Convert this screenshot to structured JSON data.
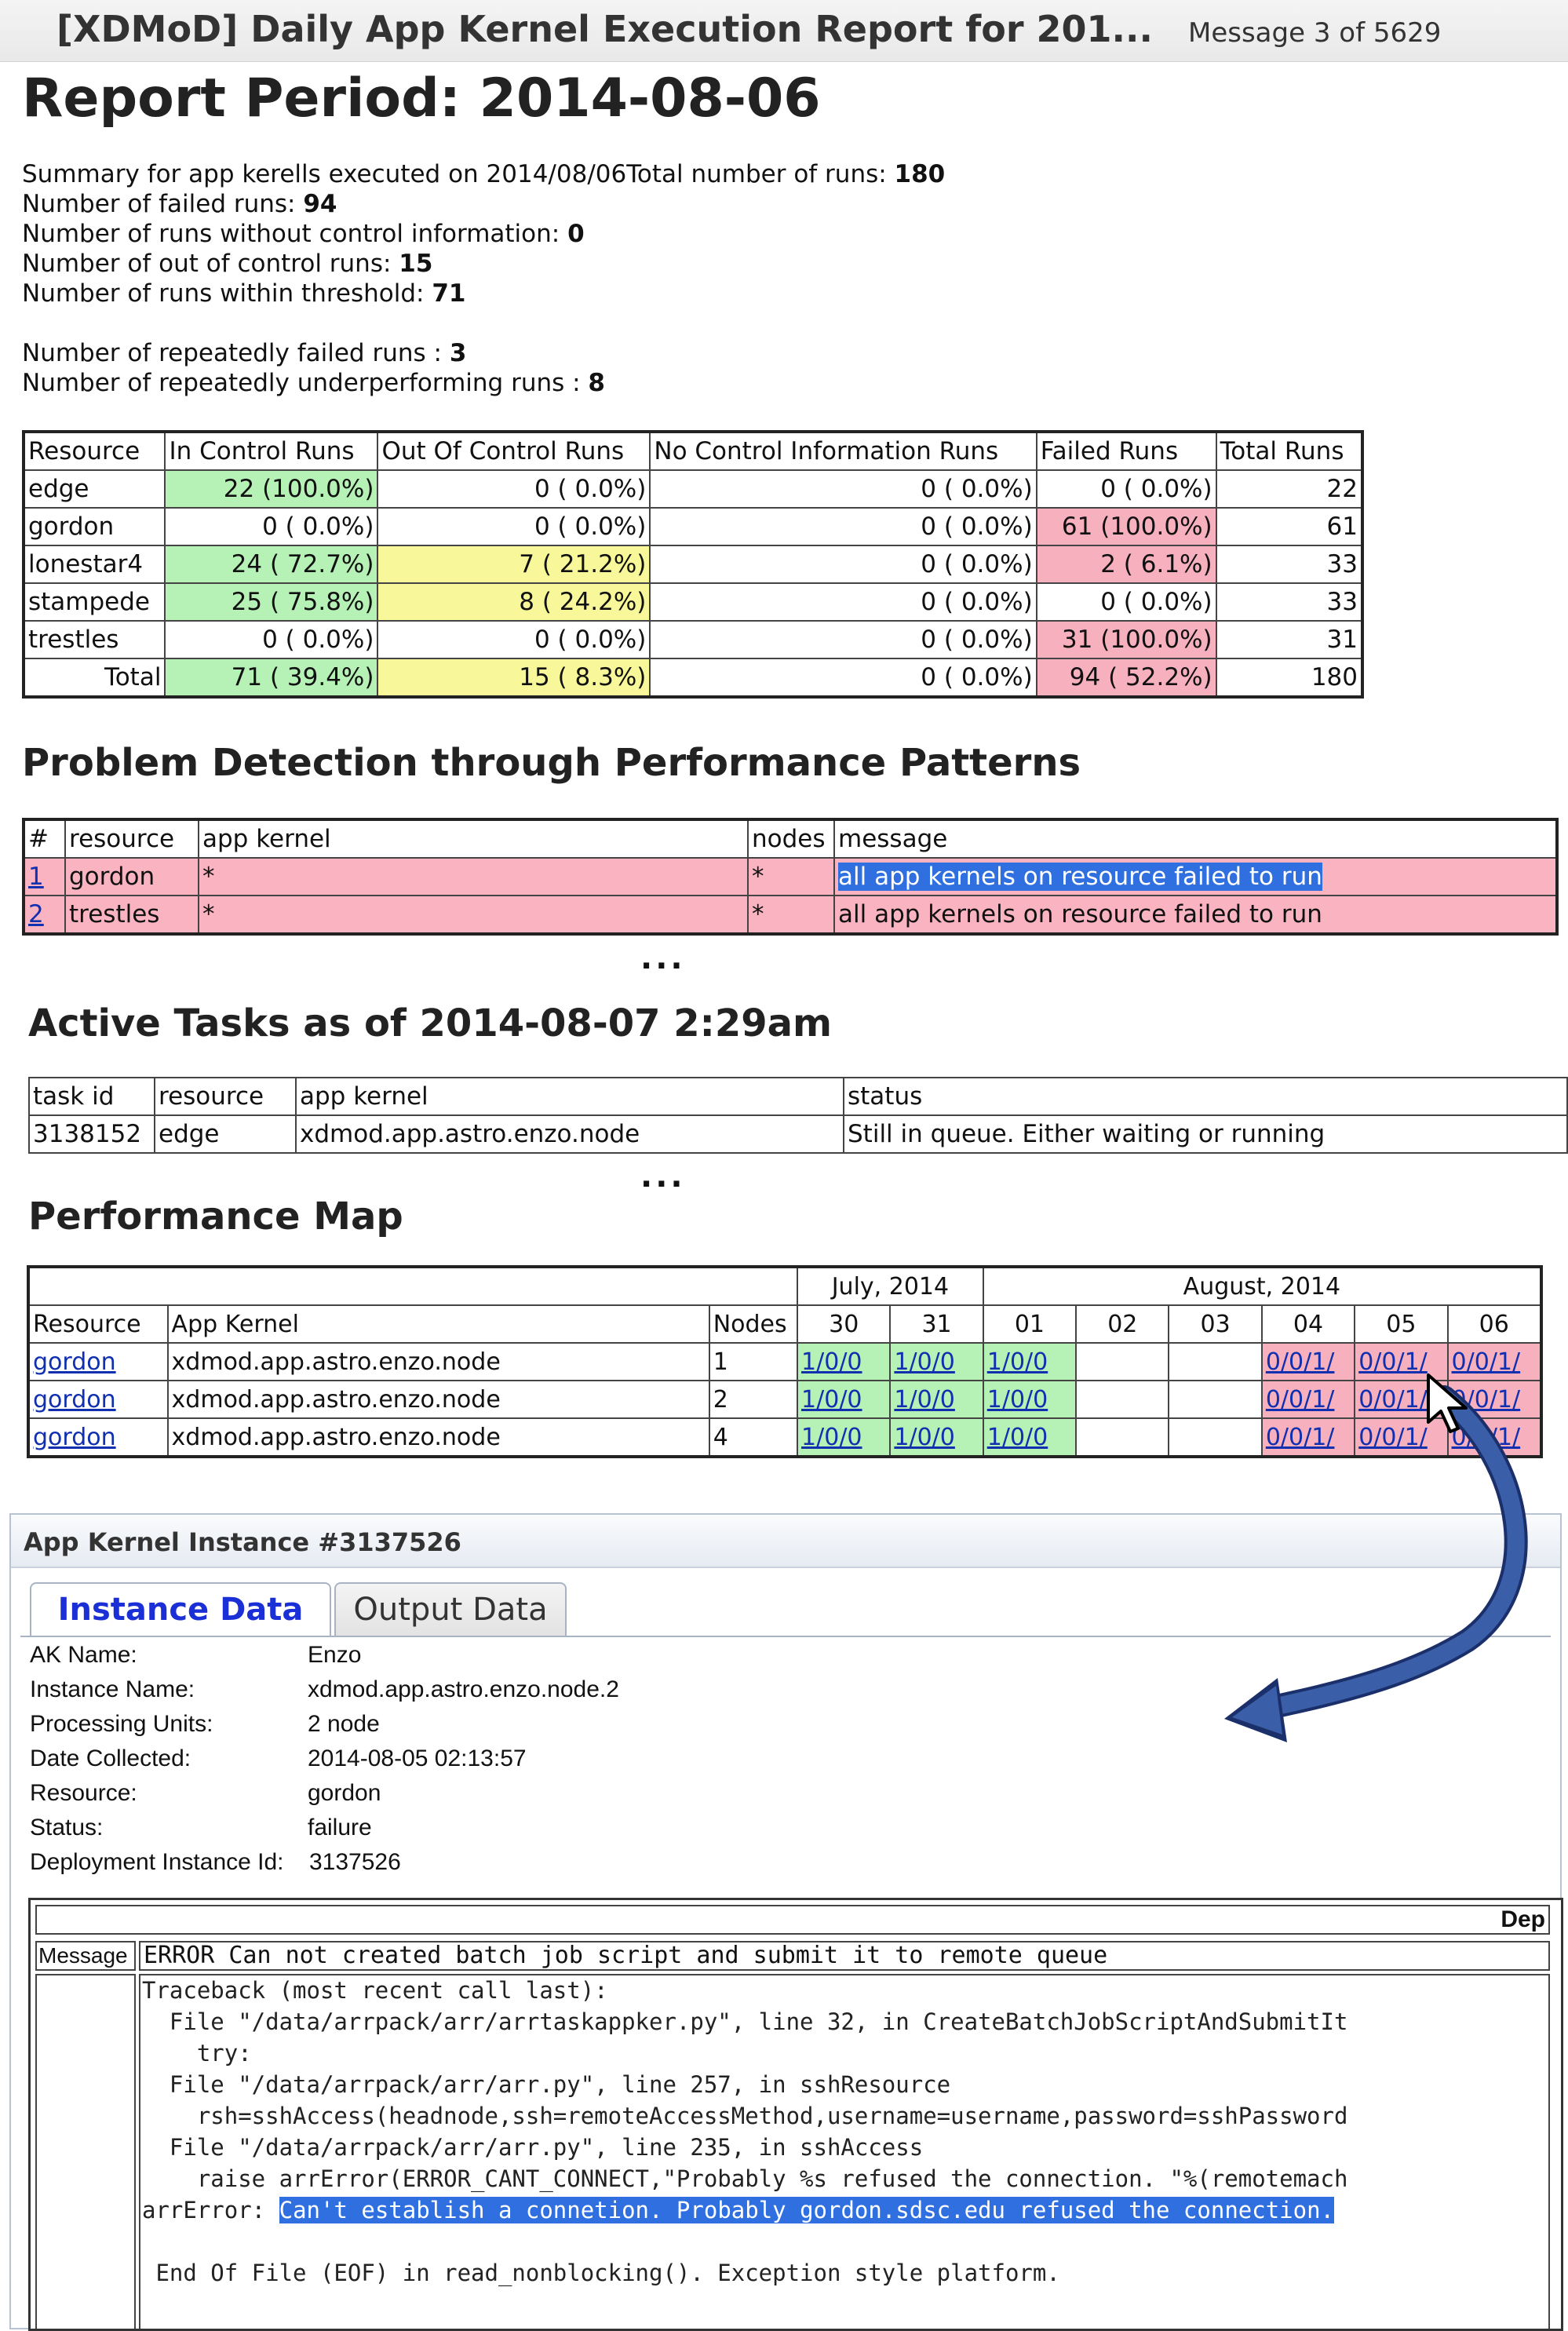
{
  "email": {
    "subject": "[XDMoD] Daily App Kernel Execution Report for 201...",
    "message_counter": "Message 3 of 5629"
  },
  "report": {
    "title": "Report Period: 2014-08-06",
    "summary_prefix": "Summary for app kerells executed on 2014/08/06",
    "total_runs_label": "Total number of runs: ",
    "total_runs": "180",
    "failed_label": "Number of failed runs: ",
    "failed": "94",
    "no_control_label": "Number of runs without control information: ",
    "no_control": "0",
    "out_of_control_label": "Number of out of control runs: ",
    "out_of_control": "15",
    "within_threshold_label": "Number of runs within threshold: ",
    "within_threshold": "71",
    "repeated_failed_label": "Number of repeatedly failed runs : ",
    "repeated_failed": "3",
    "repeated_under_label": "Number of repeatedly underperforming runs : ",
    "repeated_under": "8"
  },
  "summary_table": {
    "headers": [
      "Resource",
      "In Control Runs",
      "Out Of Control Runs",
      "No Control Information Runs",
      "Failed Runs",
      "Total Runs"
    ],
    "rows": [
      [
        "edge",
        "22 (100.0%)",
        "0 (  0.0%)",
        "0 (  0.0%)",
        "0 (  0.0%)",
        "22"
      ],
      [
        "gordon",
        "0 (  0.0%)",
        "0 (  0.0%)",
        "0 (  0.0%)",
        "61 (100.0%)",
        "61"
      ],
      [
        "lonestar4",
        "24 ( 72.7%)",
        "7 ( 21.2%)",
        "0 (  0.0%)",
        "2 (  6.1%)",
        "33"
      ],
      [
        "stampede",
        "25 ( 75.8%)",
        "8 ( 24.2%)",
        "0 (  0.0%)",
        "0 (  0.0%)",
        "33"
      ],
      [
        "trestles",
        "0 (  0.0%)",
        "0 (  0.0%)",
        "0 (  0.0%)",
        "31 (100.0%)",
        "31"
      ],
      [
        "Total",
        "71 ( 39.4%)",
        "15 (  8.3%)",
        "0 (  0.0%)",
        "94 ( 52.2%)",
        "180"
      ]
    ]
  },
  "problem_detection": {
    "title": "Problem Detection through Performance Patterns",
    "headers": [
      "#",
      "resource",
      "app kernel",
      "nodes",
      "message"
    ],
    "rows": [
      [
        "1",
        "gordon",
        "*",
        "*",
        "all app kernels on resource failed to run"
      ],
      [
        "2",
        "trestles",
        "*",
        "*",
        "all app kernels on resource failed to run"
      ]
    ]
  },
  "ellipsis": "...",
  "active_tasks": {
    "title": "Active Tasks as of 2014-08-07 2:29am",
    "headers": [
      "task id",
      "resource",
      "app kernel",
      "status"
    ],
    "rows": [
      [
        "3138152",
        "edge",
        "xdmod.app.astro.enzo.node",
        "Still in queue. Either waiting or running"
      ]
    ]
  },
  "performance_map": {
    "title": "Performance Map",
    "month1": "July, 2014",
    "month2": "August, 2014",
    "headers": [
      "Resource",
      "App Kernel",
      "Nodes",
      "30",
      "31",
      "01",
      "02",
      "03",
      "04",
      "05",
      "06"
    ],
    "rows": [
      [
        "gordon",
        "xdmod.app.astro.enzo.node",
        "1",
        "1/0/0",
        "1/0/0",
        "1/0/0",
        "",
        "",
        "0/0/1/",
        "0/0/1/",
        "0/0/1/"
      ],
      [
        "gordon",
        "xdmod.app.astro.enzo.node",
        "2",
        "1/0/0",
        "1/0/0",
        "1/0/0",
        "",
        "",
        "0/0/1/",
        "0/0/1/",
        "0/0/1/"
      ],
      [
        "gordon",
        "xdmod.app.astro.enzo.node",
        "4",
        "1/0/0",
        "1/0/0",
        "1/0/0",
        "",
        "",
        "0/0/1/",
        "0/0/1/",
        "0/0/1/"
      ]
    ]
  },
  "instance_panel": {
    "title": "App Kernel Instance #3137526",
    "tabs": [
      "Instance Data",
      "Output Data"
    ],
    "fields": [
      {
        "label": "AK Name:",
        "value": "Enzo"
      },
      {
        "label": "Instance Name:",
        "value": "xdmod.app.astro.enzo.node.2"
      },
      {
        "label": "Processing Units:",
        "value": "2 node"
      },
      {
        "label": "Date Collected:",
        "value": "2014-08-05 02:13:57"
      },
      {
        "label": "Resource:",
        "value": "gordon"
      },
      {
        "label": "Status:",
        "value": "failure"
      },
      {
        "label": "Deployment Instance Id:",
        "value": "3137526"
      }
    ],
    "detail_header": "Dep",
    "message_label": "Message",
    "message_value": "ERROR Can not created batch job script and submit it to remote queue",
    "traceback": [
      "Traceback (most recent call last):",
      "  File \"/data/arrpack/arr/arrtaskappker.py\", line 32, in CreateBatchJobScriptAndSubmitIt",
      "    try:",
      "  File \"/data/arrpack/arr/arr.py\", line 257, in sshResource",
      "    rsh=sshAccess(headnode,ssh=remoteAccessMethod,username=username,password=sshPassword",
      "  File \"/data/arrpack/arr/arr.py\", line 235, in sshAccess",
      "    raise arrError(ERROR_CANT_CONNECT,\"Probably %s refused the connection. \"%(remotemach"
    ],
    "error_prefix": "arrError: ",
    "error_highlight": "Can't establish a connetion. Probably gordon.sdsc.edu refused the connection.",
    "eof_line": " End Of File (EOF) in read_nonblocking(). Exception style platform."
  },
  "colors": {
    "in_control": "#b6f2b6",
    "out_of_control": "#f8f89a",
    "failed": "#f7b0bd",
    "arrow": "#3a5fa8",
    "highlight": "#2f6fe0"
  },
  "icons": [
    "mouse-cursor-icon",
    "curved-arrow-icon"
  ]
}
